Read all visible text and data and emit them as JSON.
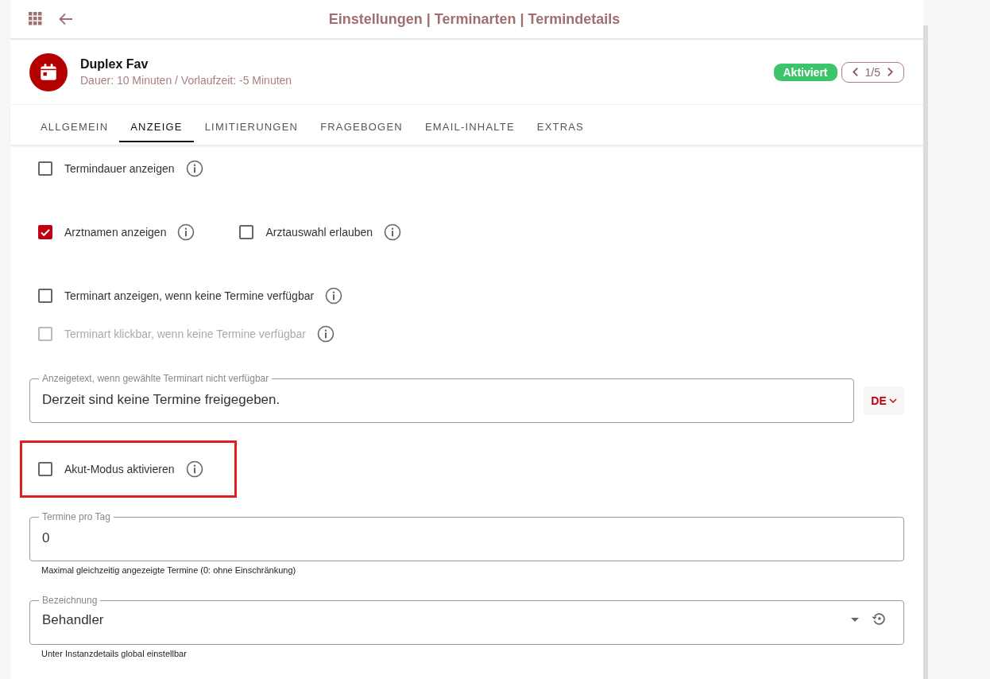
{
  "header": {
    "title": "Einstellungen | Terminarten | Termindetails"
  },
  "item": {
    "name": "Duplex Fav",
    "subtitle": "Dauer: 10 Minuten / Vorlaufzeit: -5 Minuten",
    "status": {
      "label": "Aktiviert",
      "active": true
    },
    "pager": "1/5"
  },
  "tabs": [
    {
      "label": "ALLGEMEIN",
      "selected": false
    },
    {
      "label": "ANZEIGE",
      "selected": true
    },
    {
      "label": "LIMITIERUNGEN",
      "selected": false
    },
    {
      "label": "FRAGEBOGEN",
      "selected": false
    },
    {
      "label": "EMAIL-INHALTE",
      "selected": false
    },
    {
      "label": "EXTRAS",
      "selected": false
    }
  ],
  "checkbox_rows": [
    [
      {
        "label": "Termindauer anzeigen",
        "checked": false,
        "disabled": false
      }
    ],
    [
      {
        "label": "Arztnamen anzeigen",
        "checked": true,
        "disabled": false
      },
      {
        "label": "Arztauswahl erlauben",
        "checked": false,
        "disabled": false
      }
    ],
    [
      {
        "label": "Terminart anzeigen, wenn keine Termine verfügbar",
        "checked": false,
        "disabled": false
      }
    ],
    [
      {
        "label": "Terminart klickbar, wenn keine Termine verfügbar",
        "checked": false,
        "disabled": true
      }
    ]
  ],
  "unavailable_text": {
    "label": "Anzeigetext, wenn gewählte Terminart nicht verfügbar",
    "value": "Derzeit sind keine Termine freigegeben.",
    "language": "DE"
  },
  "acute_mode": {
    "label": "Akut-Modus aktivieren",
    "checked": false,
    "highlighted": true
  },
  "appointments_per_day": {
    "label": "Termine pro Tag",
    "value": "0",
    "hint": "Maximal gleichzeitig angezeigte Termine (0: ohne Einschränkung)"
  },
  "designation": {
    "label": "Bezeichnung",
    "value": "Behandler",
    "hint": "Unter Instanzdetails global einstellbar"
  }
}
